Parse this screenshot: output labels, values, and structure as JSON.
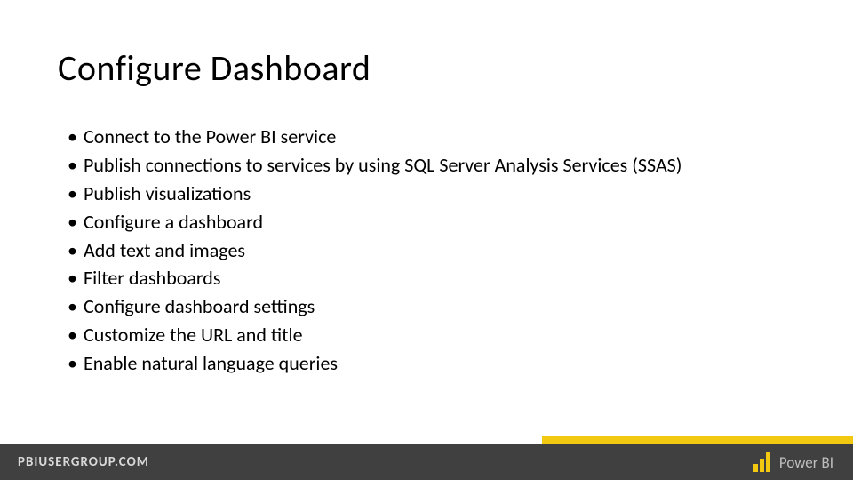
{
  "title": "Configure Dashboard",
  "bullets": [
    "Connect to the Power BI service",
    "Publish connections to services by using SQL Server Analysis Services (SSAS)",
    "Publish visualizations",
    "Configure a dashboard",
    "Add text and images",
    "Filter dashboards",
    "Configure dashboard settings",
    "Customize the URL and title",
    "Enable natural language queries"
  ],
  "footer": {
    "url_label": "PBIUSERGROUP.COM",
    "logo_text": "Power BI"
  },
  "colors": {
    "accent": "#f2c811",
    "footer_bg": "#404040"
  }
}
